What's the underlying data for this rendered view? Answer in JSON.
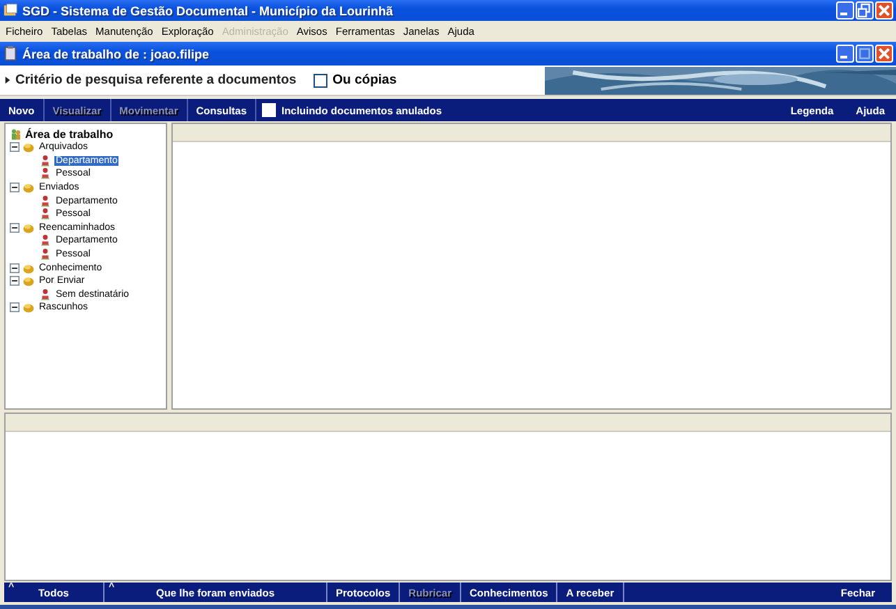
{
  "window": {
    "title": "SGD - Sistema de Gestão Documental - Município da Lourinhã"
  },
  "menu": [
    {
      "label": "Ficheiro",
      "disabled": false
    },
    {
      "label": "Tabelas",
      "disabled": false
    },
    {
      "label": "Manutenção",
      "disabled": false
    },
    {
      "label": "Exploração",
      "disabled": false
    },
    {
      "label": "Administração",
      "disabled": true
    },
    {
      "label": "Avisos",
      "disabled": false
    },
    {
      "label": "Ferramentas",
      "disabled": false
    },
    {
      "label": "Janelas",
      "disabled": false
    },
    {
      "label": "Ajuda",
      "disabled": false
    }
  ],
  "inner_window": {
    "title": "Área de trabalho de : joao.filipe"
  },
  "criteria": {
    "label": "Critério de pesquisa referente a documentos",
    "copies": {
      "label": "Ou cópias",
      "checked": false
    }
  },
  "toolbar": {
    "buttons": [
      {
        "label": "Novo",
        "disabled": false
      },
      {
        "label": "Visualizar",
        "disabled": true
      },
      {
        "label": "Movimentar",
        "disabled": true
      },
      {
        "label": "Consultas",
        "disabled": false
      }
    ],
    "include_cancelled": {
      "label": "Incluindo documentos anulados",
      "checked": false
    },
    "right_buttons": [
      "Legenda",
      "Ajuda"
    ]
  },
  "tree": {
    "label": "Área de trabalho",
    "children": [
      {
        "label": "Arquivados",
        "expanded": true,
        "children": [
          {
            "label": "Departamento",
            "selected": true
          },
          {
            "label": "Pessoal",
            "selected": false
          }
        ]
      },
      {
        "label": "Enviados",
        "expanded": true,
        "children": [
          {
            "label": "Departamento",
            "selected": false
          },
          {
            "label": "Pessoal",
            "selected": false
          }
        ]
      },
      {
        "label": "Reencaminhados",
        "expanded": true,
        "children": [
          {
            "label": "Departamento",
            "selected": false
          },
          {
            "label": "Pessoal",
            "selected": false
          }
        ]
      },
      {
        "label": "Conhecimento",
        "expanded": true
      },
      {
        "label": "Por Enviar",
        "expanded": true,
        "children": [
          {
            "label": "Sem destinatário",
            "selected": false
          }
        ]
      },
      {
        "label": "Rascunhos",
        "expanded": true
      }
    ]
  },
  "bottom_bar": {
    "tabs": [
      {
        "label": "Todos",
        "sort": "^",
        "disabled": false
      },
      {
        "label": "Que lhe foram enviados",
        "sort": "^",
        "disabled": false
      },
      {
        "label": "Protocolos",
        "disabled": false
      },
      {
        "label": "Rubricar",
        "disabled": true
      },
      {
        "label": "Conhecimentos",
        "disabled": false
      },
      {
        "label": "A receber",
        "disabled": false
      }
    ],
    "close": "Fechar"
  }
}
